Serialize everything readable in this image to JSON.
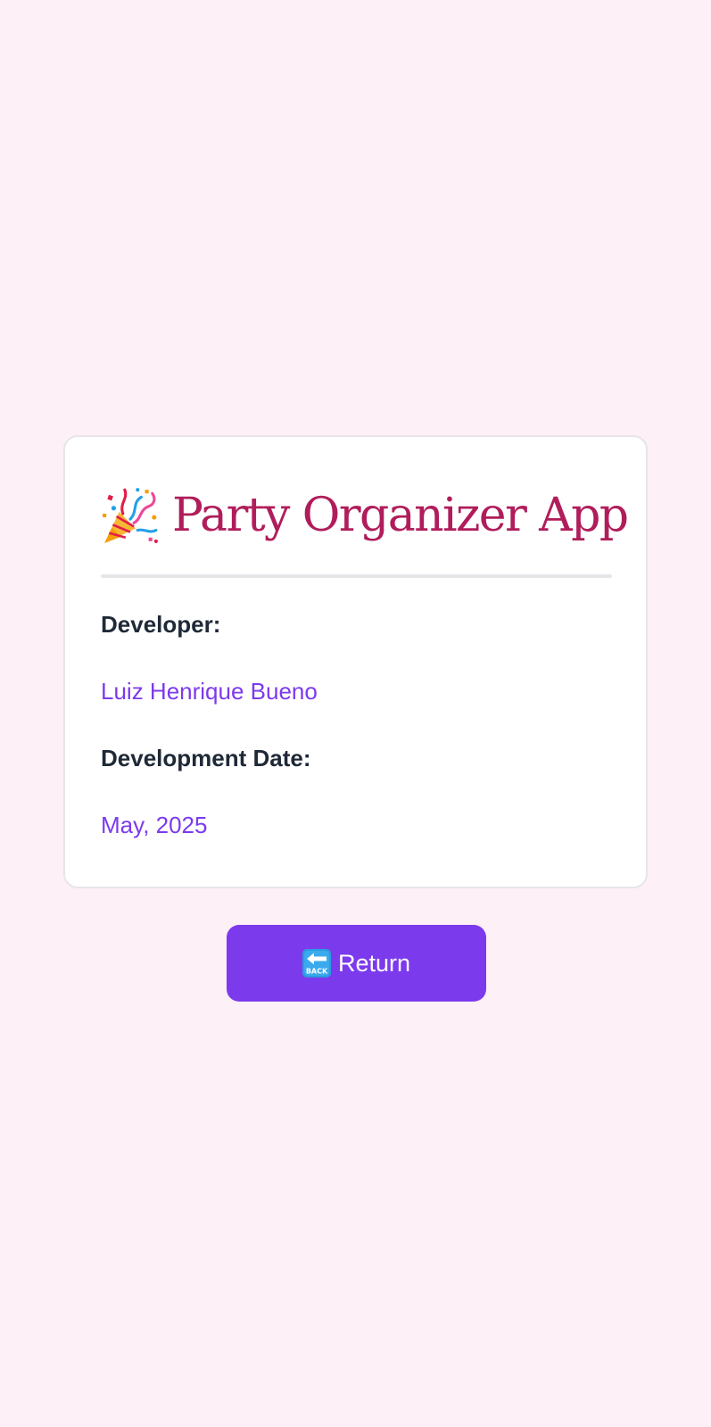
{
  "page": {
    "background_color": "#fdf0f7"
  },
  "card": {
    "title": "Party Organizer App",
    "title_icon": "party-popper-icon",
    "fields": [
      {
        "label": "Developer:",
        "value": "Luiz Henrique Bueno"
      },
      {
        "label": "Development Date:",
        "value": "May, 2025"
      }
    ]
  },
  "return_button": {
    "label": "Return",
    "icon": "back-arrow-icon"
  },
  "colors": {
    "title": "#b01d5a",
    "value": "#7c3aed",
    "label": "#1f2937",
    "button": "#7c3aed"
  }
}
